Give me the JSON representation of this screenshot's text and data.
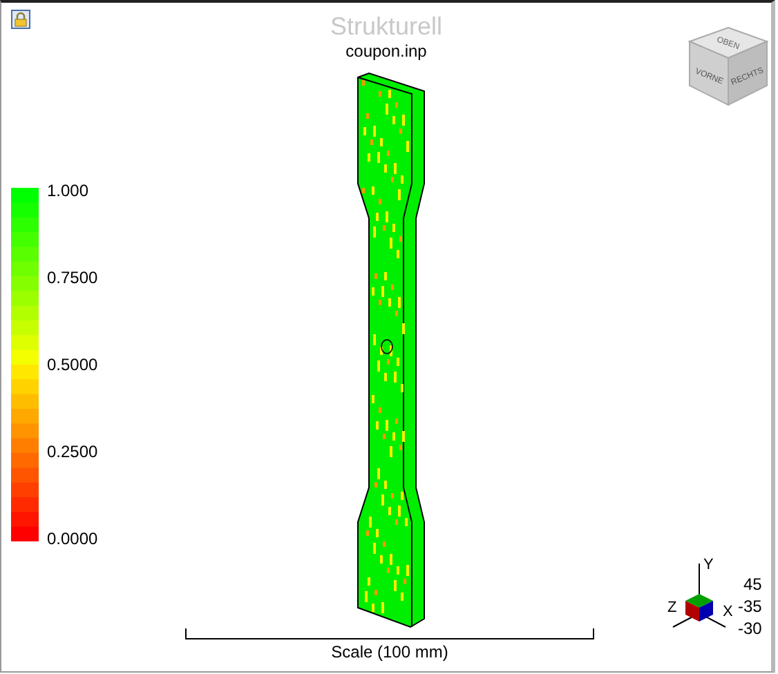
{
  "title": "Strukturell",
  "model_name": "coupon.inp",
  "legend": {
    "labels": [
      "1.000",
      "0.7500",
      "0.5000",
      "0.2500",
      "0.0000"
    ]
  },
  "view_cube": {
    "faces": [
      "OBEN",
      "VORNE",
      "RECHTS"
    ]
  },
  "triad": {
    "axes": [
      "Y",
      "Z",
      "X"
    ],
    "angles": [
      "45",
      "-35",
      "-30"
    ]
  },
  "scale_bar": {
    "label": "Scale (100 mm)"
  }
}
